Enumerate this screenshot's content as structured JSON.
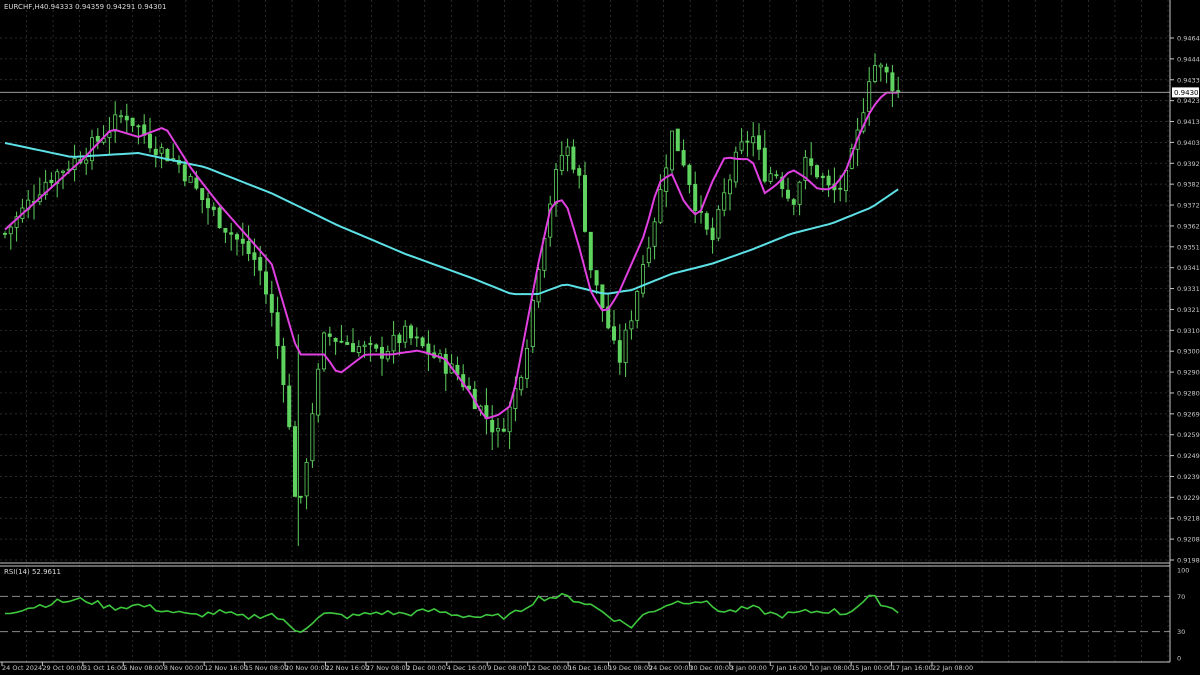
{
  "header": {
    "symbol": "EURCHF,H4",
    "ohlc": "0.94333 0.94359 0.94291 0.94301"
  },
  "colors": {
    "background": "#000000",
    "grid": "#3a3a3a",
    "candle": "#5fd35f",
    "ma_fast": "#e040e0",
    "ma_slow": "#5ce1e6",
    "rsi": "#3ec83e",
    "axis_text": "#c8c8c8",
    "border": "#c8c8c8"
  },
  "price_axis": {
    "current_price": "0.94301",
    "ticks": [
      "0.94645",
      "0.94440",
      "0.94335",
      "0.94235",
      "0.94130",
      "0.94030",
      "0.93925",
      "0.93825",
      "0.93720",
      "0.93620",
      "0.93515",
      "0.93415",
      "0.93310",
      "0.93210",
      "0.93105",
      "0.93005",
      "0.92900",
      "0.92800",
      "0.92695",
      "0.92595",
      "0.92495",
      "0.92390",
      "0.92290",
      "0.92185",
      "0.92085",
      "0.91980"
    ]
  },
  "rsi_panel": {
    "label": "RSI(14) 52.9611",
    "ticks": [
      "100",
      "70",
      "30",
      "0"
    ]
  },
  "time_axis": {
    "labels": [
      "24 Oct 2024",
      "29 Oct 00:00",
      "31 Oct 16:00",
      "5 Nov 08:00",
      "8 Nov 00:00",
      "12 Nov 16:00",
      "15 Nov 08:00",
      "20 Nov 00:00",
      "22 Nov 16:00",
      "27 Nov 08:00",
      "2 Dec 00:00",
      "4 Dec 16:00",
      "9 Dec 08:00",
      "12 Dec 00:00",
      "16 Dec 16:00",
      "19 Dec 08:00",
      "24 Dec 00:00",
      "30 Dec 00:00",
      "3 Jan 00:00",
      "7 Jan 16:00",
      "10 Jan 08:00",
      "15 Jan 00:00",
      "17 Jan 16:00",
      "22 Jan 08:00"
    ]
  },
  "chart_data": [
    {
      "type": "candlestick",
      "title": "EURCHF,H4",
      "ylim": [
        0.9198,
        0.947
      ],
      "close_path": [
        [
          0,
          0.936
        ],
        [
          3,
          0.9386
        ],
        [
          6,
          0.94
        ],
        [
          9,
          0.942
        ],
        [
          11,
          0.9405
        ],
        [
          13,
          0.9395
        ],
        [
          15,
          0.9375
        ],
        [
          17,
          0.936
        ],
        [
          19,
          0.9345
        ],
        [
          20,
          0.932
        ],
        [
          21,
          0.9285
        ],
        [
          22,
          0.9215
        ],
        [
          23,
          0.927
        ],
        [
          24,
          0.931
        ],
        [
          26,
          0.9305
        ],
        [
          28,
          0.93
        ],
        [
          30,
          0.931
        ],
        [
          32,
          0.93
        ],
        [
          34,
          0.929
        ],
        [
          36,
          0.927
        ],
        [
          37,
          0.926
        ],
        [
          38,
          0.9275
        ],
        [
          39,
          0.93
        ],
        [
          40,
          0.9345
        ],
        [
          41,
          0.938
        ],
        [
          42,
          0.9405
        ],
        [
          43,
          0.939
        ],
        [
          44,
          0.934
        ],
        [
          45,
          0.932
        ],
        [
          46,
          0.9295
        ],
        [
          47,
          0.932
        ],
        [
          48,
          0.935
        ],
        [
          49,
          0.9375
        ],
        [
          50,
          0.941
        ],
        [
          51,
          0.9395
        ],
        [
          52,
          0.937
        ],
        [
          53,
          0.9355
        ],
        [
          54,
          0.938
        ],
        [
          55,
          0.94
        ],
        [
          56,
          0.941
        ],
        [
          57,
          0.939
        ],
        [
          58,
          0.939
        ],
        [
          59,
          0.9375
        ],
        [
          60,
          0.9395
        ],
        [
          61,
          0.939
        ],
        [
          62,
          0.938
        ],
        [
          63,
          0.9385
        ],
        [
          64,
          0.941
        ],
        [
          65,
          0.9445
        ],
        [
          66,
          0.944
        ],
        [
          67,
          0.943
        ]
      ],
      "ma_fast_path": [
        [
          0,
          0.9362
        ],
        [
          3,
          0.938
        ],
        [
          6,
          0.9398
        ],
        [
          8,
          0.9412
        ],
        [
          10,
          0.9408
        ],
        [
          12,
          0.9413
        ],
        [
          14,
          0.9392
        ],
        [
          16,
          0.9375
        ],
        [
          18,
          0.936
        ],
        [
          20,
          0.9345
        ],
        [
          22,
          0.93
        ],
        [
          24,
          0.93
        ],
        [
          25,
          0.929
        ],
        [
          27,
          0.93
        ],
        [
          29,
          0.93
        ],
        [
          31,
          0.9302
        ],
        [
          33,
          0.9298
        ],
        [
          35,
          0.928
        ],
        [
          36,
          0.9268
        ],
        [
          37,
          0.927
        ],
        [
          38,
          0.9275
        ],
        [
          39,
          0.931
        ],
        [
          40,
          0.9345
        ],
        [
          41,
          0.9375
        ],
        [
          42,
          0.9377
        ],
        [
          43,
          0.9355
        ],
        [
          44,
          0.933
        ],
        [
          45,
          0.932
        ],
        [
          46,
          0.933
        ],
        [
          47,
          0.9345
        ],
        [
          48,
          0.936
        ],
        [
          49,
          0.9385
        ],
        [
          50,
          0.939
        ],
        [
          51,
          0.9375
        ],
        [
          52,
          0.9368
        ],
        [
          53,
          0.9385
        ],
        [
          54,
          0.9398
        ],
        [
          55,
          0.9397
        ],
        [
          56,
          0.9397
        ],
        [
          57,
          0.938
        ],
        [
          58,
          0.9385
        ],
        [
          59,
          0.9392
        ],
        [
          60,
          0.9388
        ],
        [
          61,
          0.9382
        ],
        [
          62,
          0.9382
        ],
        [
          63,
          0.939
        ],
        [
          64,
          0.9408
        ],
        [
          65,
          0.9422
        ],
        [
          66,
          0.943
        ],
        [
          67,
          0.943
        ]
      ],
      "ma_slow_path": [
        [
          0,
          0.9405
        ],
        [
          5,
          0.9398
        ],
        [
          10,
          0.94
        ],
        [
          15,
          0.9393
        ],
        [
          20,
          0.938
        ],
        [
          25,
          0.9364
        ],
        [
          30,
          0.935
        ],
        [
          35,
          0.9338
        ],
        [
          38,
          0.933
        ],
        [
          40,
          0.933
        ],
        [
          42,
          0.9335
        ],
        [
          45,
          0.933
        ],
        [
          47,
          0.9332
        ],
        [
          50,
          0.934
        ],
        [
          53,
          0.9345
        ],
        [
          56,
          0.9352
        ],
        [
          59,
          0.936
        ],
        [
          62,
          0.9365
        ],
        [
          65,
          0.9373
        ],
        [
          67,
          0.9382
        ]
      ],
      "series": [
        {
          "name": "Price",
          "kind": "candles"
        },
        {
          "name": "MA fast",
          "kind": "line"
        },
        {
          "name": "MA slow",
          "kind": "line"
        }
      ]
    },
    {
      "type": "line",
      "title": "RSI(14) 52.9611",
      "ylim": [
        0,
        100
      ],
      "levels": [
        70,
        30
      ],
      "path": [
        [
          0,
          52
        ],
        [
          2,
          58
        ],
        [
          4,
          64
        ],
        [
          6,
          66
        ],
        [
          8,
          57
        ],
        [
          10,
          60
        ],
        [
          12,
          54
        ],
        [
          14,
          48
        ],
        [
          16,
          52
        ],
        [
          18,
          46
        ],
        [
          20,
          50
        ],
        [
          22,
          30
        ],
        [
          24,
          50
        ],
        [
          26,
          47
        ],
        [
          28,
          52
        ],
        [
          30,
          50
        ],
        [
          32,
          54
        ],
        [
          34,
          49
        ],
        [
          36,
          46
        ],
        [
          38,
          48
        ],
        [
          40,
          68
        ],
        [
          42,
          70
        ],
        [
          44,
          60
        ],
        [
          46,
          42
        ],
        [
          47,
          36
        ],
        [
          48,
          50
        ],
        [
          50,
          63
        ],
        [
          52,
          66
        ],
        [
          54,
          52
        ],
        [
          56,
          57
        ],
        [
          58,
          48
        ],
        [
          60,
          52
        ],
        [
          62,
          54
        ],
        [
          63,
          50
        ],
        [
          65,
          70
        ],
        [
          66,
          60
        ],
        [
          67,
          53
        ]
      ]
    }
  ]
}
